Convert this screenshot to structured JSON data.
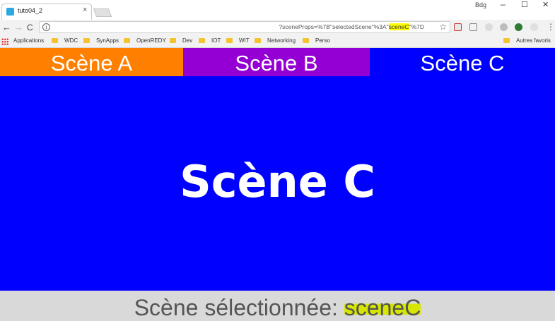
{
  "browser": {
    "tab": {
      "title": "tuto04_2",
      "close": "×"
    },
    "window": {
      "user": "Bdg",
      "minimize": "–",
      "maximize": "☐",
      "close": "✕"
    },
    "nav": {
      "back": "←",
      "forward": "→",
      "reload": "C"
    },
    "omnibox": {
      "info": "i",
      "url_prefix": "?sceneProps=%7B\"selectedScene\"%3A\"",
      "url_highlight": "sceneC",
      "url_suffix": "\"%7D"
    },
    "star": "☆",
    "menu": "⋮"
  },
  "bookmarks": {
    "items": [
      "Applications",
      "WDC",
      "SynApps",
      "OpenREDY",
      "Dev",
      "IOT",
      "WIT",
      "Networking",
      "Perso"
    ],
    "other": "Autres favoris"
  },
  "app": {
    "tabs": [
      {
        "label": "Scène A",
        "color": "#ff8000"
      },
      {
        "label": "Scène B",
        "color": "#9400d3"
      },
      {
        "label": "Scène C",
        "color": "#0000ff"
      }
    ],
    "stage": {
      "title": "Scène C",
      "color": "#0000ff"
    },
    "footer": {
      "label": "Scène sélectionnée: ",
      "value": "sceneC"
    }
  }
}
